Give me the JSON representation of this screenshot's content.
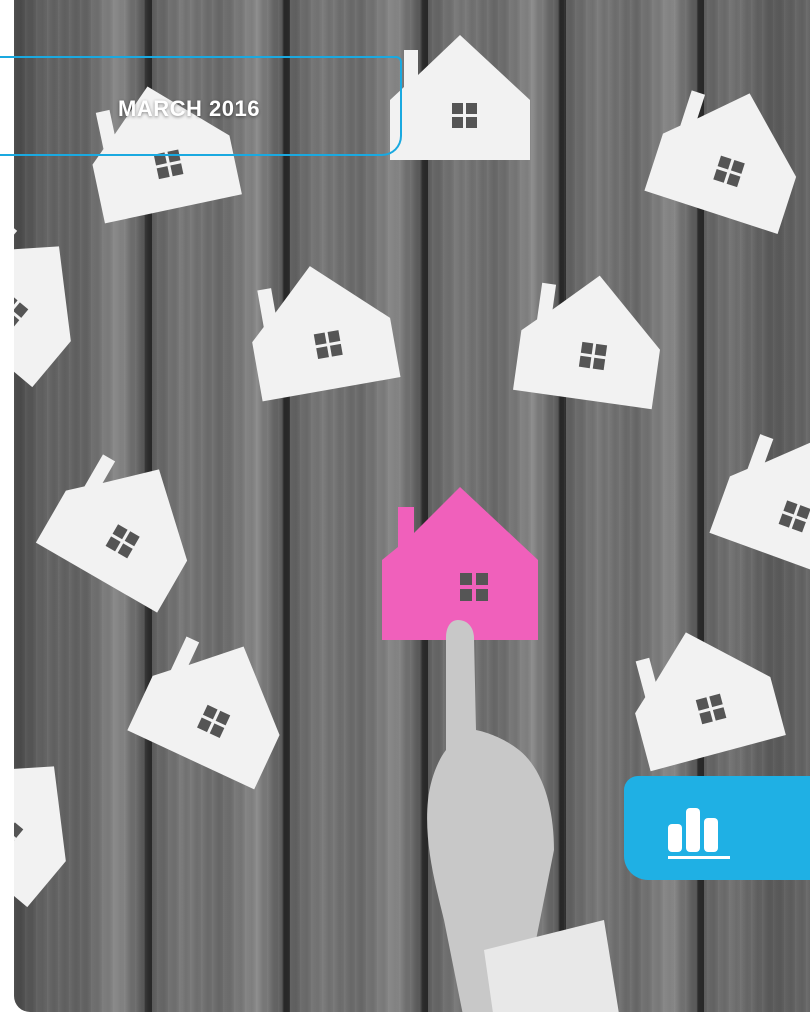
{
  "cover": {
    "date_label": "MARCH 2016"
  },
  "colors": {
    "accent_blue": "#1fb0e4",
    "highlight_house": "#f060bb",
    "paper_house": "#f2f2f2"
  },
  "icons": {
    "report_badge": "bar-chart-icon"
  }
}
